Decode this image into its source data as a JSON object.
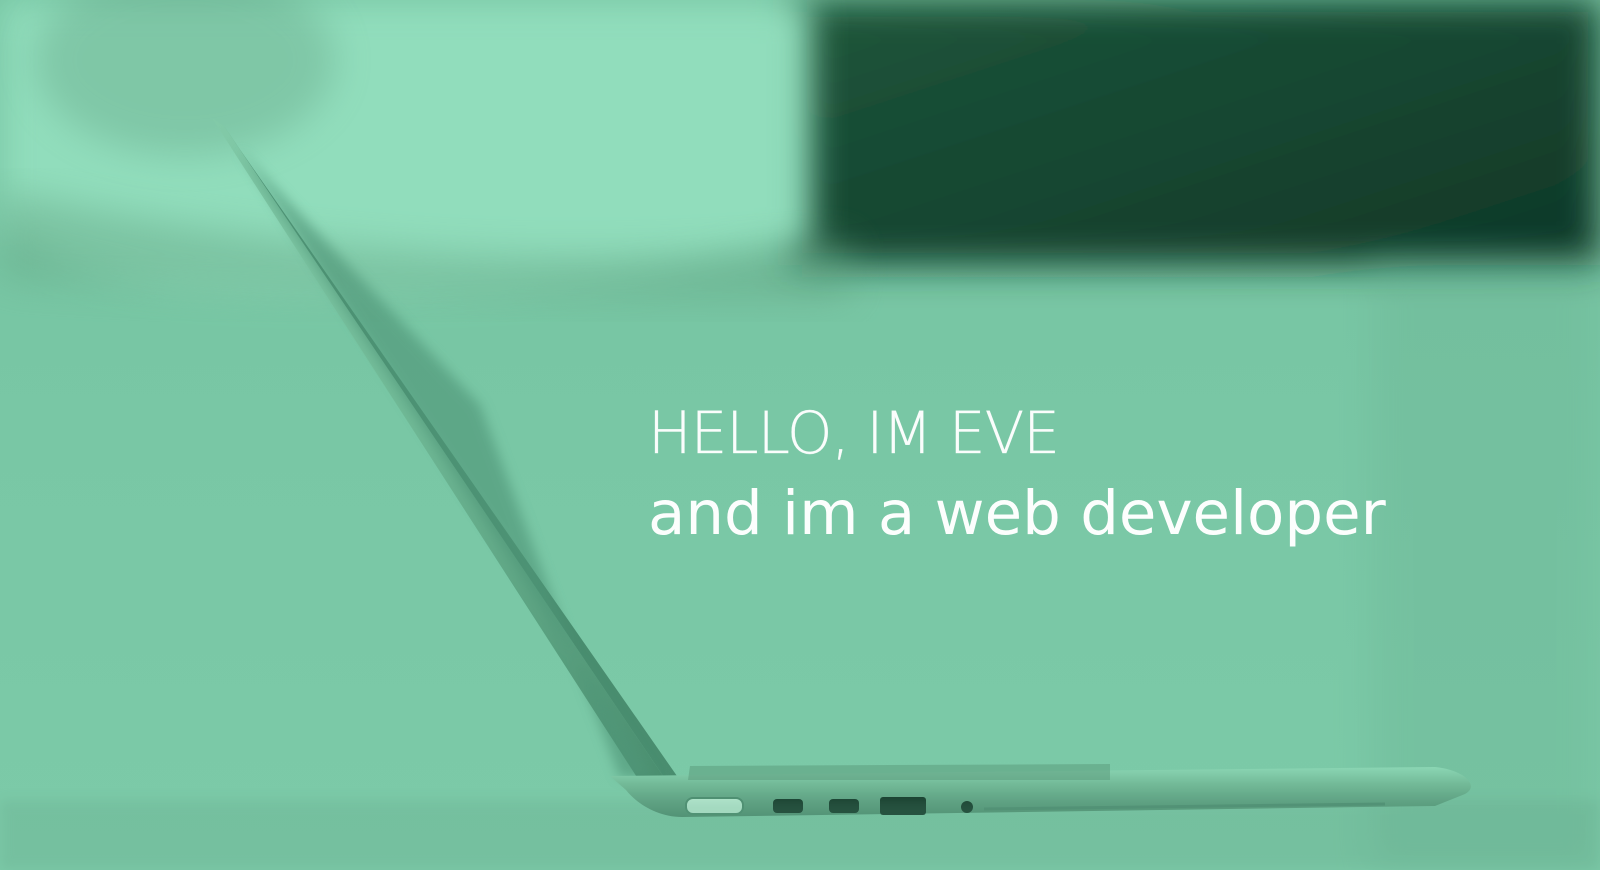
{
  "hero": {
    "headline": "HELLO, IM EVE",
    "subheadline": "and im a web developer"
  },
  "colors": {
    "overlay": "#7ccaa8",
    "text": "#f4fff9",
    "dark_background": "#123e2b"
  }
}
